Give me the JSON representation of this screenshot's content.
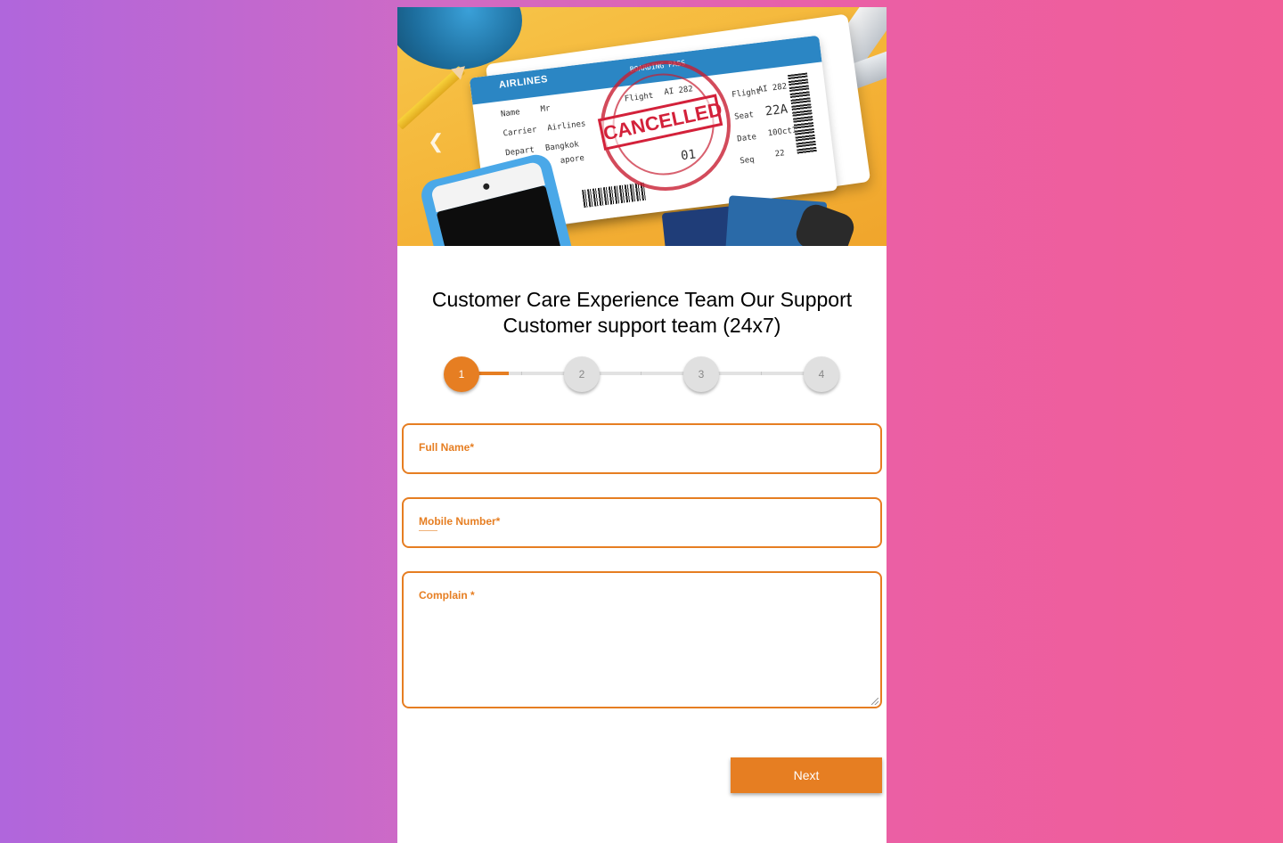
{
  "banner": {
    "image_alt": "Cancelled flight ticket",
    "ticket": {
      "airline": "AIRLINES",
      "name_label": "Name",
      "name_value": "Mr",
      "carrier_label": "Carrier",
      "carrier_value": "Airlines",
      "depart_label": "Depart",
      "depart_value": "Bangkok",
      "to_value": "apore",
      "flight_label": "Flight",
      "flight_value": "AI 282",
      "seat_label": "Seat",
      "seat_value": "22A",
      "date_label": "Date",
      "date_value": "10Oct14",
      "seq_label": "Seq",
      "seq_value": "22",
      "boarding_label": "BOARDING PASS",
      "stamp_text": "CANCELLED",
      "stub_number": "01"
    },
    "prev_icon": "chevron-left-icon",
    "next_icon": "chevron-right-icon",
    "prev_glyph": "❮",
    "next_glyph": "❯"
  },
  "title": {
    "line1": "Customer Care Experience Team Our Support",
    "line2": "Customer support team (24x7)"
  },
  "stepper": {
    "steps": [
      "1",
      "2",
      "3",
      "4"
    ],
    "current": 1,
    "progress_fraction": 0.13
  },
  "form": {
    "full_name": {
      "label": "Full Name*",
      "value": ""
    },
    "mobile": {
      "label": "Mobile Number*",
      "value": ""
    },
    "complain": {
      "label": "Complain *",
      "value": ""
    }
  },
  "next_button": {
    "label": "Next"
  },
  "colors": {
    "accent": "#e67e22",
    "background_left": "#b066dc",
    "background_right": "#f15e97",
    "step_inactive": "#e0e0e0"
  }
}
